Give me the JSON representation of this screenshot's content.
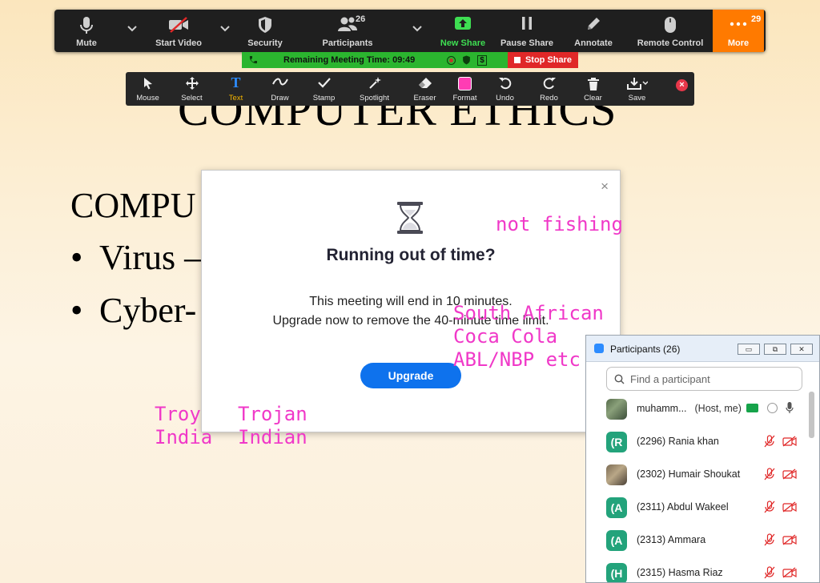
{
  "slide": {
    "title": "COMPUTER ETHICS",
    "heading": "COMPU",
    "bullet1": "Virus –",
    "bullet2": "Cyber-",
    "bullet_symbol": "•"
  },
  "annotations": {
    "not_fishing": "not fishing",
    "companies": "South African\nCoca Cola\nABL/NBP etc",
    "troy": "Troy\nIndia",
    "trojan": "Trojan\nIndian",
    "color": "#f038c8"
  },
  "toolbar": {
    "mute": "Mute",
    "start_video": "Start Video",
    "security": "Security",
    "participants": "Participants",
    "participants_count": "26",
    "new_share": "New Share",
    "pause_share": "Pause Share",
    "annotate": "Annotate",
    "remote_control": "Remote Control",
    "more": "More",
    "more_count": "29"
  },
  "meeting_bar": {
    "remaining": "Remaining Meeting Time: 09:49",
    "stop_share": "Stop Share",
    "dollar": "$"
  },
  "annotation_toolbar": {
    "mouse": "Mouse",
    "select": "Select",
    "text": "Text",
    "draw": "Draw",
    "stamp": "Stamp",
    "spotlight": "Spotlight",
    "eraser": "Eraser",
    "format": "Format",
    "undo": "Undo",
    "redo": "Redo",
    "clear": "Clear",
    "save": "Save",
    "text_glyph": "T",
    "close": "×"
  },
  "dialog": {
    "title": "Running out of time?",
    "line1": "This meeting will end in 10 minutes.",
    "line2": "Upgrade now to remove the 40-minute time limit.",
    "button": "Upgrade",
    "close": "×"
  },
  "participants_panel": {
    "title": "Participants (26)",
    "search_placeholder": "Find a participant",
    "minimize": "▭",
    "restore": "⧉",
    "close": "✕",
    "rows": [
      {
        "avatar": "",
        "name": "muhamm...",
        "tag": "(Host, me)"
      },
      {
        "avatar": "(R",
        "name": "(2296) Rania khan",
        "tag": ""
      },
      {
        "avatar": "",
        "name": "(2302) Humair Shoukat",
        "tag": ""
      },
      {
        "avatar": "(A",
        "name": "(2311) Abdul Wakeel",
        "tag": ""
      },
      {
        "avatar": "(A",
        "name": "(2313) Ammara",
        "tag": ""
      },
      {
        "avatar": "(H",
        "name": "(2315) Hasma Riaz",
        "tag": ""
      }
    ]
  }
}
